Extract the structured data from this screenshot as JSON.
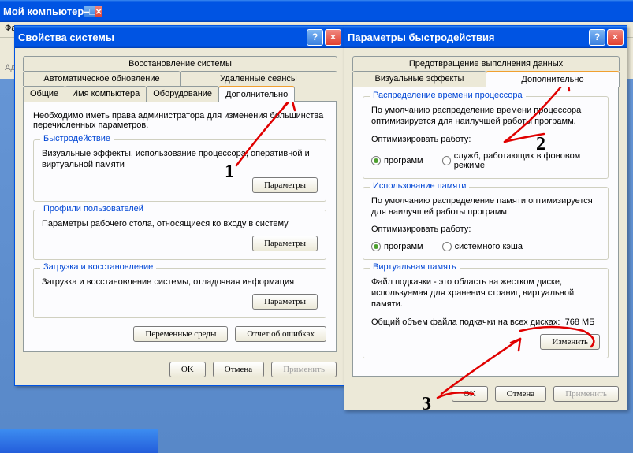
{
  "parent": {
    "title": "Мой компьютер",
    "menu_file": "Фа",
    "addr_label": "Адр"
  },
  "sysProps": {
    "title": "Свойства системы",
    "tabsTop": [
      "Восстановление системы"
    ],
    "tabsTop2": [
      "Автоматическое обновление",
      "Удаленные сеансы"
    ],
    "tabsBot": [
      "Общие",
      "Имя компьютера",
      "Оборудование",
      "Дополнительно"
    ],
    "intro": "Необходимо иметь права администратора для изменения большинства перечисленных параметров.",
    "perf": {
      "legend": "Быстродействие",
      "text": "Визуальные эффекты, использование процессора, оперативной и виртуальной памяти",
      "btn": "Параметры"
    },
    "profiles": {
      "legend": "Профили пользователей",
      "text": "Параметры рабочего стола, относящиеся ко входу в систему",
      "btn": "Параметры"
    },
    "startup": {
      "legend": "Загрузка и восстановление",
      "text": "Загрузка и восстановление системы, отладочная информация",
      "btn": "Параметры"
    },
    "envBtn": "Переменные среды",
    "errBtn": "Отчет об ошибках",
    "ok": "OK",
    "cancel": "Отмена",
    "apply": "Применить"
  },
  "perfOpts": {
    "title": "Параметры быстродействия",
    "tabsTop": [
      "Предотвращение выполнения данных"
    ],
    "tabsBot": [
      "Визуальные эффекты",
      "Дополнительно"
    ],
    "cpu": {
      "legend": "Распределение времени процессора",
      "text": "По умолчанию распределение времени процессора оптимизируется для наилучшей работы программ.",
      "optLabel": "Оптимизировать работу:",
      "r1": "программ",
      "r2": "служб, работающих в фоновом режиме"
    },
    "mem": {
      "legend": "Использование памяти",
      "text": "По умолчанию распределение памяти оптимизируется для наилучшей работы программ.",
      "optLabel": "Оптимизировать работу:",
      "r1": "программ",
      "r2": "системного кэша"
    },
    "vmem": {
      "legend": "Виртуальная память",
      "text": "Файл подкачки - это область на жестком диске, используемая для хранения страниц виртуальной памяти.",
      "totalLabel": "Общий объем файла подкачки на всех дисках:",
      "totalValue": "768 МБ",
      "btn": "Изменить"
    },
    "ok": "OK",
    "cancel": "Отмена",
    "apply": "Применить"
  }
}
